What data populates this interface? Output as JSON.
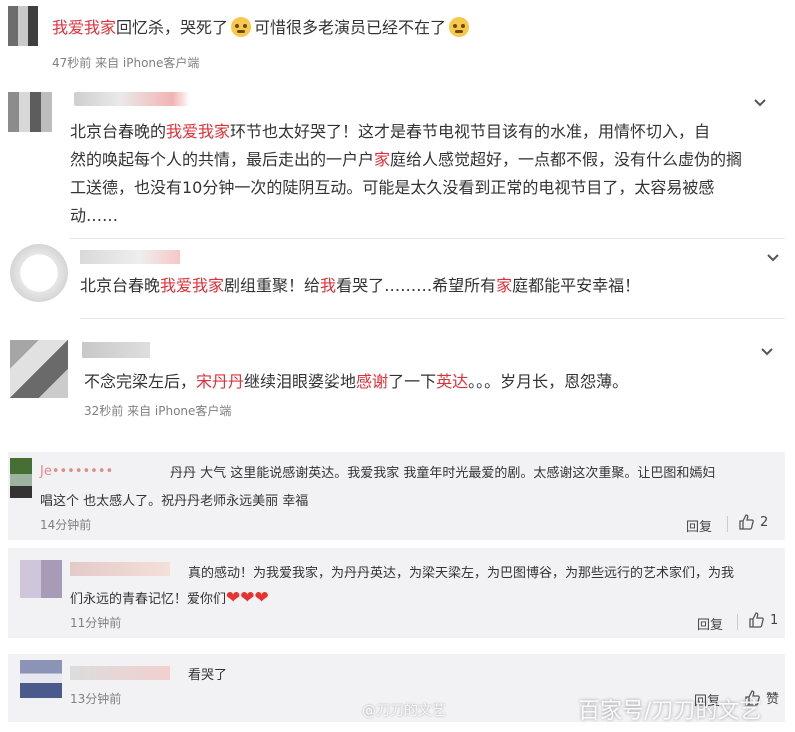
{
  "comments": [
    {
      "text_prefix_hl": "我爱我家",
      "text_main": "回忆杀，哭死了",
      "text_mid": "可惜很多老演员已经不在了",
      "meta": "47秒前 来自 iPhone客户端"
    },
    {
      "author_mask": "uarr•••",
      "line1_a": "北京台春晚的",
      "line1_hl": "我爱我家",
      "line1_b": "环节也太好哭了！这才是春节电视节目该有的水准，用情怀切入，自",
      "line2_a": "然的唤起每个人的共情，最后走出的一户户",
      "line2_hl": "家",
      "line2_b": "庭给人感觉超好，一点都不假，没有什么虚伪的搁",
      "line3": "工送德，也没有10分钟一次的陡阴互动。可能是太久没看到正常的电视节目了，太容易被感",
      "line4": "动……"
    },
    {
      "p1": "北京台春晚",
      "p1_hl": "我爱我家",
      "p2": "剧组重聚！给",
      "p2_hl": "我",
      "p3": "看哭了………希望所有",
      "p3_hl": "家",
      "p4": "庭都能平安幸福！"
    },
    {
      "p1": "不念完梁左后，",
      "p1_hl": "宋丹丹",
      "p2": "继续泪眼婆娑地",
      "p2_hl": "感谢",
      "p3": "了一下",
      "p3_hl": "英达",
      "p4": "。。。岁月长，恩怨薄。",
      "meta": "32秒前 来自 iPhone客户端"
    }
  ],
  "replies": [
    {
      "author_mask": "Je••••••••",
      "line1": "丹丹 大气 这里能说感谢英达。我爱我家 我童年时光最爱的剧。太感谢这次重聚。让巴图和嫣妇",
      "line2": "唱这个 也太感人了。祝丹丹老师永远美丽 幸福",
      "time": "14分钟前",
      "reply_label": "回复",
      "likes": "2"
    },
    {
      "line1": "真的感动！为我爱我家，为丹丹英达，为梁天梁左，为巴图博谷，为那些远行的艺术家们，为我",
      "line2": "们永远的青春记忆！爱你们",
      "time": "11分钟前",
      "reply_label": "回复",
      "likes": "1"
    },
    {
      "line1": "看哭了",
      "time": "13分钟前",
      "reply_label": "回复",
      "likes": "赞"
    }
  ],
  "watermarks": {
    "small": "@刀刀的文艺",
    "large": "百家号/刀刀的文艺"
  },
  "colors": {
    "highlight": "#e0313a",
    "meta": "#808080",
    "card_bg": "#f2f2f5",
    "heart": "#e8322f"
  },
  "icons": [
    "crying-emoji-icon",
    "chevron-down-icon",
    "thumbs-up-icon",
    "heart-icon"
  ]
}
